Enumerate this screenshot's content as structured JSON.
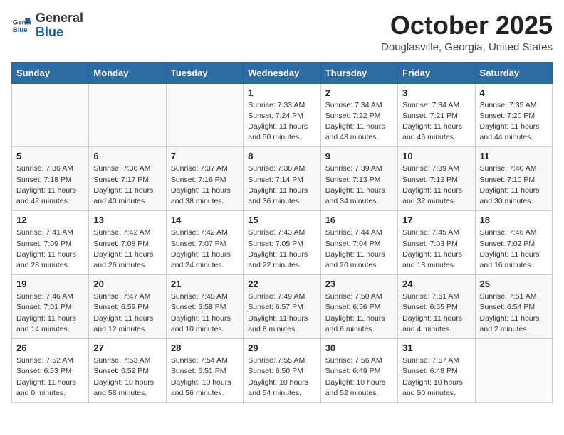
{
  "header": {
    "logo_general": "General",
    "logo_blue": "Blue",
    "month_title": "October 2025",
    "location": "Douglasville, Georgia, United States"
  },
  "weekdays": [
    "Sunday",
    "Monday",
    "Tuesday",
    "Wednesday",
    "Thursday",
    "Friday",
    "Saturday"
  ],
  "weeks": [
    [
      {
        "day": "",
        "info": ""
      },
      {
        "day": "",
        "info": ""
      },
      {
        "day": "",
        "info": ""
      },
      {
        "day": "1",
        "info": "Sunrise: 7:33 AM\nSunset: 7:24 PM\nDaylight: 11 hours\nand 50 minutes."
      },
      {
        "day": "2",
        "info": "Sunrise: 7:34 AM\nSunset: 7:22 PM\nDaylight: 11 hours\nand 48 minutes."
      },
      {
        "day": "3",
        "info": "Sunrise: 7:34 AM\nSunset: 7:21 PM\nDaylight: 11 hours\nand 46 minutes."
      },
      {
        "day": "4",
        "info": "Sunrise: 7:35 AM\nSunset: 7:20 PM\nDaylight: 11 hours\nand 44 minutes."
      }
    ],
    [
      {
        "day": "5",
        "info": "Sunrise: 7:36 AM\nSunset: 7:18 PM\nDaylight: 11 hours\nand 42 minutes."
      },
      {
        "day": "6",
        "info": "Sunrise: 7:36 AM\nSunset: 7:17 PM\nDaylight: 11 hours\nand 40 minutes."
      },
      {
        "day": "7",
        "info": "Sunrise: 7:37 AM\nSunset: 7:16 PM\nDaylight: 11 hours\nand 38 minutes."
      },
      {
        "day": "8",
        "info": "Sunrise: 7:38 AM\nSunset: 7:14 PM\nDaylight: 11 hours\nand 36 minutes."
      },
      {
        "day": "9",
        "info": "Sunrise: 7:39 AM\nSunset: 7:13 PM\nDaylight: 11 hours\nand 34 minutes."
      },
      {
        "day": "10",
        "info": "Sunrise: 7:39 AM\nSunset: 7:12 PM\nDaylight: 11 hours\nand 32 minutes."
      },
      {
        "day": "11",
        "info": "Sunrise: 7:40 AM\nSunset: 7:10 PM\nDaylight: 11 hours\nand 30 minutes."
      }
    ],
    [
      {
        "day": "12",
        "info": "Sunrise: 7:41 AM\nSunset: 7:09 PM\nDaylight: 11 hours\nand 28 minutes."
      },
      {
        "day": "13",
        "info": "Sunrise: 7:42 AM\nSunset: 7:08 PM\nDaylight: 11 hours\nand 26 minutes."
      },
      {
        "day": "14",
        "info": "Sunrise: 7:42 AM\nSunset: 7:07 PM\nDaylight: 11 hours\nand 24 minutes."
      },
      {
        "day": "15",
        "info": "Sunrise: 7:43 AM\nSunset: 7:05 PM\nDaylight: 11 hours\nand 22 minutes."
      },
      {
        "day": "16",
        "info": "Sunrise: 7:44 AM\nSunset: 7:04 PM\nDaylight: 11 hours\nand 20 minutes."
      },
      {
        "day": "17",
        "info": "Sunrise: 7:45 AM\nSunset: 7:03 PM\nDaylight: 11 hours\nand 18 minutes."
      },
      {
        "day": "18",
        "info": "Sunrise: 7:46 AM\nSunset: 7:02 PM\nDaylight: 11 hours\nand 16 minutes."
      }
    ],
    [
      {
        "day": "19",
        "info": "Sunrise: 7:46 AM\nSunset: 7:01 PM\nDaylight: 11 hours\nand 14 minutes."
      },
      {
        "day": "20",
        "info": "Sunrise: 7:47 AM\nSunset: 6:59 PM\nDaylight: 11 hours\nand 12 minutes."
      },
      {
        "day": "21",
        "info": "Sunrise: 7:48 AM\nSunset: 6:58 PM\nDaylight: 11 hours\nand 10 minutes."
      },
      {
        "day": "22",
        "info": "Sunrise: 7:49 AM\nSunset: 6:57 PM\nDaylight: 11 hours\nand 8 minutes."
      },
      {
        "day": "23",
        "info": "Sunrise: 7:50 AM\nSunset: 6:56 PM\nDaylight: 11 hours\nand 6 minutes."
      },
      {
        "day": "24",
        "info": "Sunrise: 7:51 AM\nSunset: 6:55 PM\nDaylight: 11 hours\nand 4 minutes."
      },
      {
        "day": "25",
        "info": "Sunrise: 7:51 AM\nSunset: 6:54 PM\nDaylight: 11 hours\nand 2 minutes."
      }
    ],
    [
      {
        "day": "26",
        "info": "Sunrise: 7:52 AM\nSunset: 6:53 PM\nDaylight: 11 hours\nand 0 minutes."
      },
      {
        "day": "27",
        "info": "Sunrise: 7:53 AM\nSunset: 6:52 PM\nDaylight: 10 hours\nand 58 minutes."
      },
      {
        "day": "28",
        "info": "Sunrise: 7:54 AM\nSunset: 6:51 PM\nDaylight: 10 hours\nand 56 minutes."
      },
      {
        "day": "29",
        "info": "Sunrise: 7:55 AM\nSunset: 6:50 PM\nDaylight: 10 hours\nand 54 minutes."
      },
      {
        "day": "30",
        "info": "Sunrise: 7:56 AM\nSunset: 6:49 PM\nDaylight: 10 hours\nand 52 minutes."
      },
      {
        "day": "31",
        "info": "Sunrise: 7:57 AM\nSunset: 6:48 PM\nDaylight: 10 hours\nand 50 minutes."
      },
      {
        "day": "",
        "info": ""
      }
    ]
  ]
}
